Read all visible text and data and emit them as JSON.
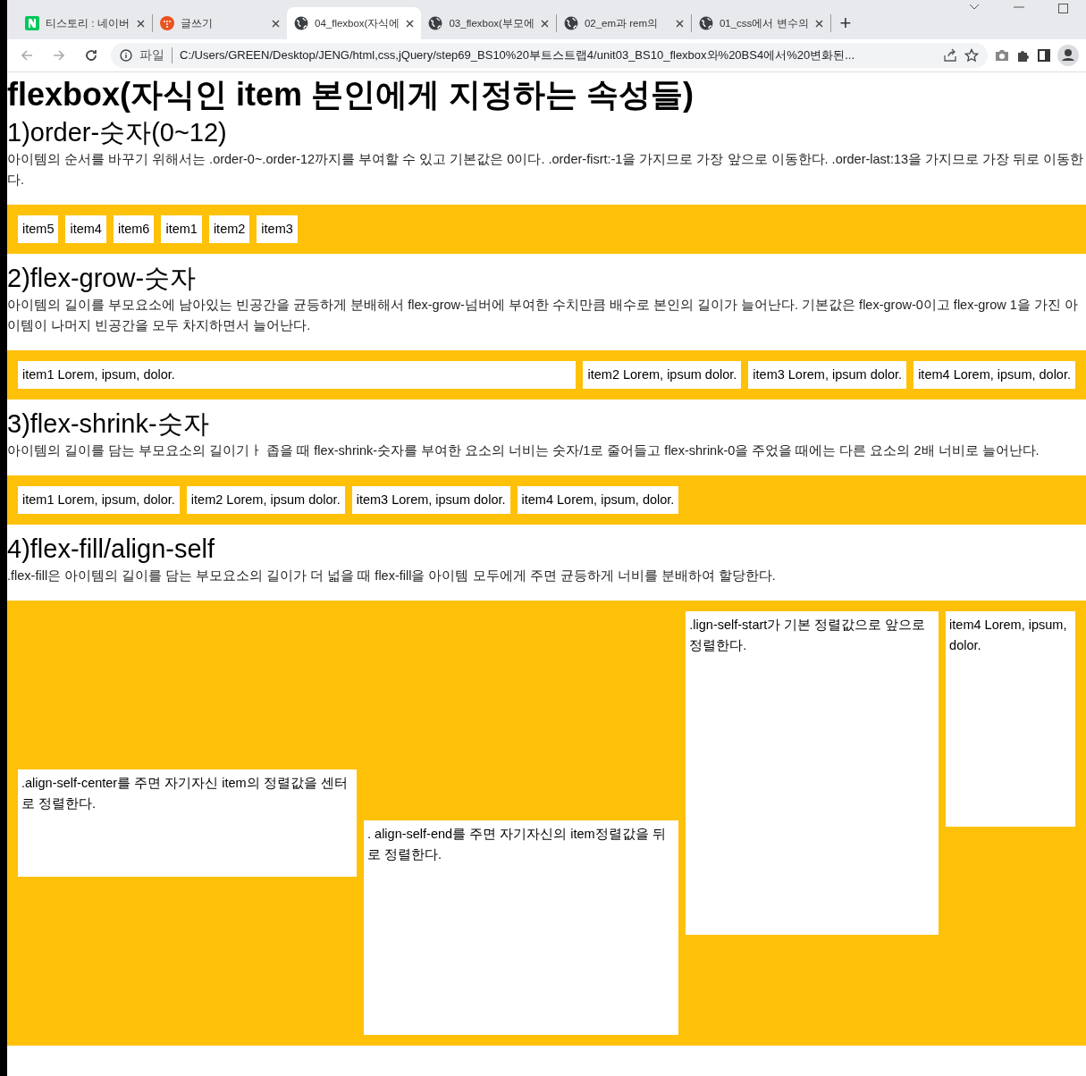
{
  "browser": {
    "tabs": [
      {
        "title": "티스토리 : 네이버",
        "selected": false
      },
      {
        "title": "글쓰기",
        "selected": false
      },
      {
        "title": "04_flexbox(자식에",
        "selected": true
      },
      {
        "title": "03_flexbox(부모에",
        "selected": false
      },
      {
        "title": "02_em과 rem의",
        "selected": false
      },
      {
        "title": "01_css에서 변수의",
        "selected": false
      }
    ],
    "new_tab": "+",
    "address": {
      "scheme": "파일",
      "url": "C:/Users/GREEN/Desktop/JENG/html,css,jQuery/step69_BS10%20부트스트랩4/unit03_BS10_flexbox와%20BS4에서%20변화된..."
    }
  },
  "page": {
    "title": "flexbox(자식인 item 본인에게 지정하는 속성들)",
    "sections": [
      {
        "heading": "1)order-숫자(0~12)",
        "text": "아이템의 순서를 바꾸기 위해서는 .order-0~.order-12까지를 부여할 수 있고 기본값은 0이다. .order-fisrt:-1을 가지므로 가장 앞으로 이동한다. .order-last:13을 가지므로 가장 뒤로 이동한다.",
        "kind": "row",
        "items": [
          {
            "text": "item5"
          },
          {
            "text": "item4"
          },
          {
            "text": "item6"
          },
          {
            "text": "item1"
          },
          {
            "text": "item2"
          },
          {
            "text": "item3"
          }
        ]
      },
      {
        "heading": "2)flex-grow-숫자",
        "text": "아이템의 길이를 부모요소에 남아있는 빈공간을 균등하게 분배해서 flex-grow-넘버에 부여한 수치만큼 배수로 본인의 길이가 늘어난다. 기본값은 flex-grow-0이고 flex-grow 1을 가진 아이템이 나머지 빈공간을 모두 차지하면서 늘어난다.",
        "kind": "row",
        "items": [
          {
            "text": "item1 Lorem, ipsum, dolor.",
            "grow": true
          },
          {
            "text": "item2 Lorem, ipsum dolor.",
            "grow": false
          },
          {
            "text": "item3 Lorem, ipsum dolor.",
            "grow": false
          },
          {
            "text": "item4 Lorem, ipsum, dolor.",
            "grow": false
          }
        ]
      },
      {
        "heading": "3)flex-shrink-숫자",
        "text": "아이템의 길이를 담는 부모요소의 길이기ㅏ 좁을 때 flex-shrink-숫자를 부여한 요소의 너비는 숫자/1로 줄어들고 flex-shrink-0을 주었을 때에는 다른 요소의 2배 너비로 늘어난다.",
        "kind": "row",
        "items": [
          {
            "text": "item1 Lorem, ipsum, dolor."
          },
          {
            "text": "item2 Lorem, ipsum dolor."
          },
          {
            "text": "item3 Lorem, ipsum dolor."
          },
          {
            "text": "item4 Lorem, ipsum, dolor."
          }
        ]
      },
      {
        "heading": "4)flex-fill/align-self",
        "text": ".flex-fill은 아이템의 길이를 담는 부모요소의 길이가 더 넓을 때 flex-fill을 아이템 모두에게 주면 균등하게 너비를 분배하여 할당한다.",
        "kind": "align",
        "items": [
          {
            "text": ".align-self-center를 주면 자기자신 item의 정렬값을 센터로 정렬한다."
          },
          {
            "text": ". align-self-end를 주면 자기자신의 item정렬값을 뒤로 정렬한다."
          },
          {
            "text": ".lign-self-start가 기본 정렬값으로 앞으로 정렬한다."
          },
          {
            "text": "item4 Lorem, ipsum, dolor."
          }
        ]
      }
    ]
  }
}
